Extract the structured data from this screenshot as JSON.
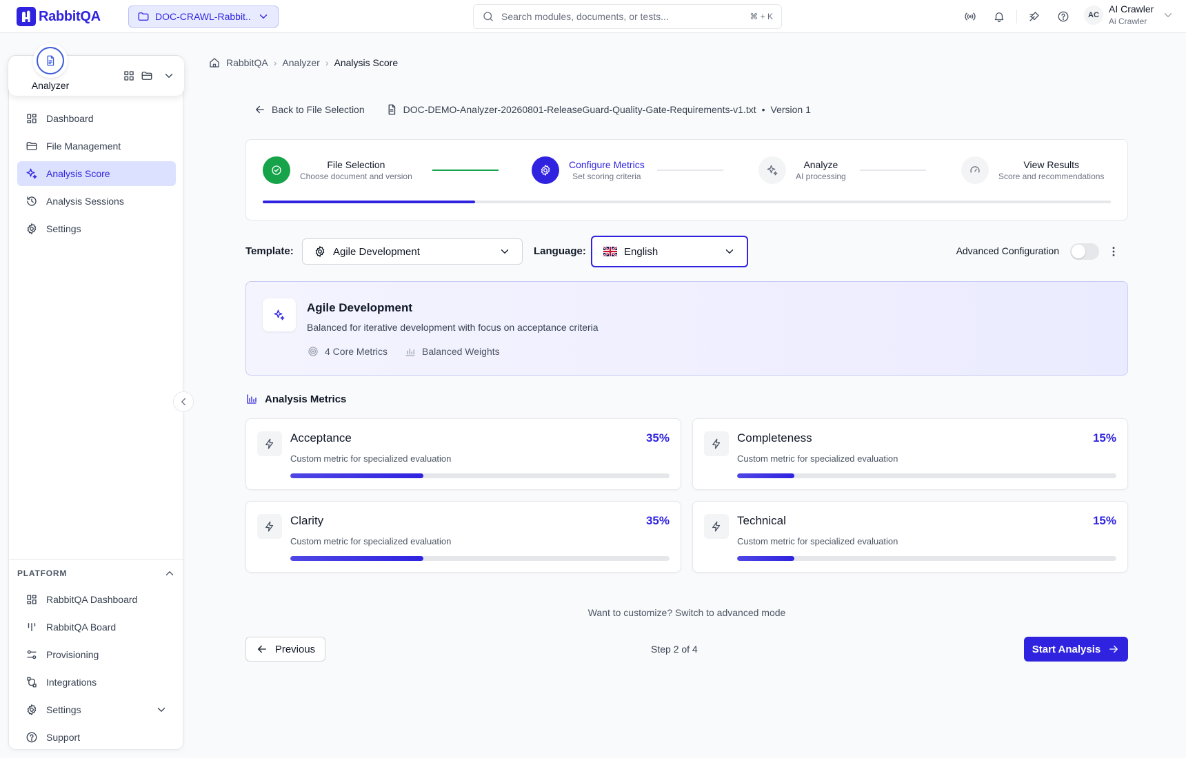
{
  "app": {
    "name": "RabbitQA"
  },
  "project": {
    "label": "DOC-CRAWL-Rabbit..."
  },
  "search": {
    "placeholder": "Search modules, documents, or tests...",
    "shortcut": "⌘ + K"
  },
  "user": {
    "initials": "AC",
    "name": "AI Crawler",
    "subtitle": "Ai Crawler"
  },
  "module": {
    "name": "Analyzer"
  },
  "sidebar": {
    "items": [
      {
        "label": "Dashboard",
        "icon": "dashboard-icon"
      },
      {
        "label": "File Management",
        "icon": "folder-icon"
      },
      {
        "label": "Analysis Score",
        "icon": "sparkles-icon",
        "active": true
      },
      {
        "label": "Analysis Sessions",
        "icon": "history-icon"
      },
      {
        "label": "Settings",
        "icon": "gear-icon"
      }
    ],
    "platform_header": "PLATFORM",
    "platform_items": [
      {
        "label": "RabbitQA Dashboard",
        "icon": "dashboard-icon"
      },
      {
        "label": "RabbitQA Board",
        "icon": "board-icon"
      },
      {
        "label": "Provisioning",
        "icon": "provisioning-icon"
      },
      {
        "label": "Integrations",
        "icon": "integrations-icon"
      },
      {
        "label": "Settings",
        "icon": "gear-icon"
      },
      {
        "label": "Support",
        "icon": "help-icon"
      }
    ]
  },
  "breadcrumb": [
    "RabbitQA",
    "Analyzer",
    "Analysis Score"
  ],
  "file": {
    "back_label": "Back to File Selection",
    "filename": "DOC-DEMO-Analyzer-20260801-ReleaseGuard-Quality-Gate-Requirements-v1.txt",
    "separator": "•",
    "version": "Version 1"
  },
  "steps": [
    {
      "title": "File Selection",
      "subtitle": "Choose document and version",
      "state": "done"
    },
    {
      "title": "Configure Metrics",
      "subtitle": "Set scoring criteria",
      "state": "current"
    },
    {
      "title": "Analyze",
      "subtitle": "AI processing",
      "state": "todo"
    },
    {
      "title": "View Results",
      "subtitle": "Score and recommendations",
      "state": "todo"
    }
  ],
  "progress_fraction": 0.25,
  "config": {
    "template_label": "Template:",
    "template_value": "Agile Development",
    "language_label": "Language:",
    "language_value": "English",
    "advanced_label": "Advanced Configuration",
    "advanced_enabled": false
  },
  "template_card": {
    "name": "Agile Development",
    "description": "Balanced for iterative development with focus on acceptance criteria",
    "meta_metrics": "4 Core Metrics",
    "meta_weights": "Balanced Weights"
  },
  "metrics_header": "Analysis Metrics",
  "metrics": [
    {
      "name": "Acceptance",
      "percent_label": "35%",
      "percent": 35,
      "description": "Custom metric for specialized evaluation"
    },
    {
      "name": "Completeness",
      "percent_label": "15%",
      "percent": 15,
      "description": "Custom metric for specialized evaluation"
    },
    {
      "name": "Clarity",
      "percent_label": "35%",
      "percent": 35,
      "description": "Custom metric for specialized evaluation"
    },
    {
      "name": "Technical",
      "percent_label": "15%",
      "percent": 15,
      "description": "Custom metric for specialized evaluation"
    }
  ],
  "footer": {
    "hint": "Want to customize? Switch to advanced mode",
    "previous_label": "Previous",
    "step_count": "Step 2 of 4",
    "start_label": "Start Analysis"
  },
  "colors": {
    "accent": "#2f23e0",
    "success": "#16a34a",
    "active_nav_bg": "#dbe1ff"
  }
}
